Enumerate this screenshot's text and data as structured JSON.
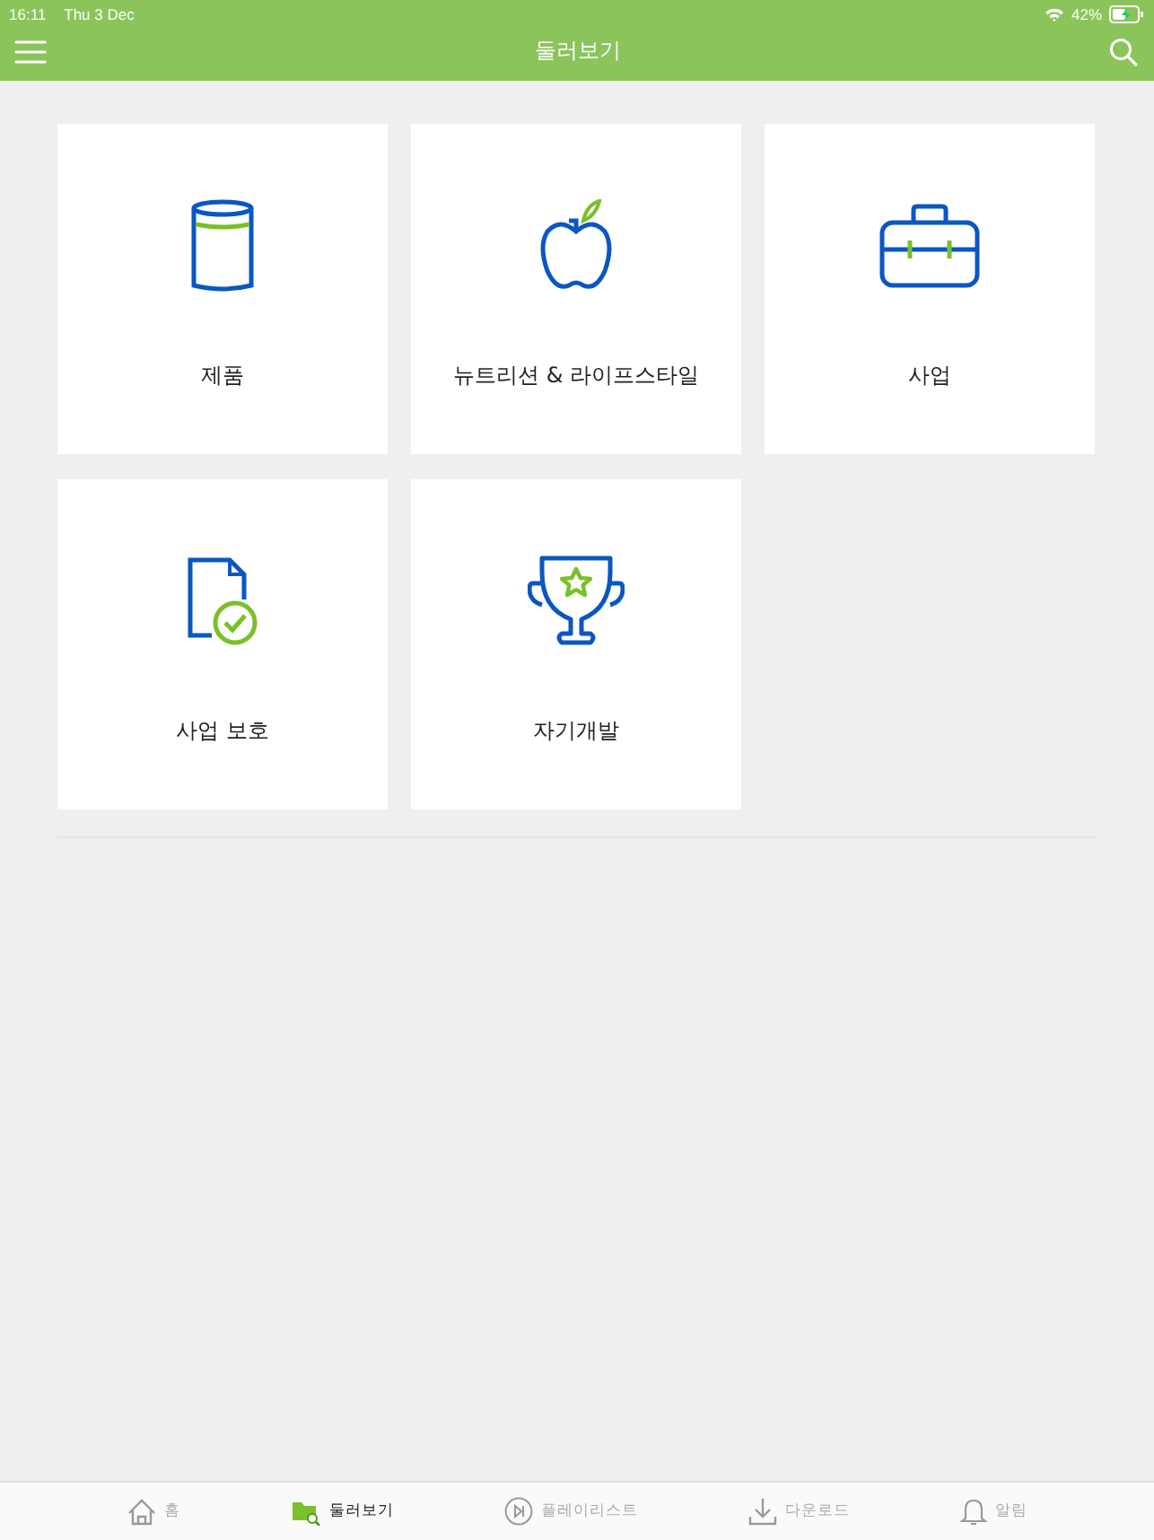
{
  "status_bar": {
    "time": "16:11",
    "date": "Thu 3 Dec",
    "battery": "42%"
  },
  "header": {
    "title": "둘러보기"
  },
  "tiles": [
    {
      "kind": "can",
      "label": "제품"
    },
    {
      "kind": "apple",
      "label": "뉴트리션 & 라이프스타일"
    },
    {
      "kind": "briefcase",
      "label": "사업"
    },
    {
      "kind": "document",
      "label": "사업 보호"
    },
    {
      "kind": "trophy",
      "label": "자기개발"
    }
  ],
  "tab_bar": [
    {
      "kind": "home",
      "label": "홈",
      "selected": false
    },
    {
      "kind": "browse",
      "label": "둘러보기",
      "selected": true
    },
    {
      "kind": "playlist",
      "label": "플레이리스트",
      "selected": false
    },
    {
      "kind": "download",
      "label": "다운로드",
      "selected": false
    },
    {
      "kind": "bell",
      "label": "알림",
      "selected": false
    }
  ]
}
